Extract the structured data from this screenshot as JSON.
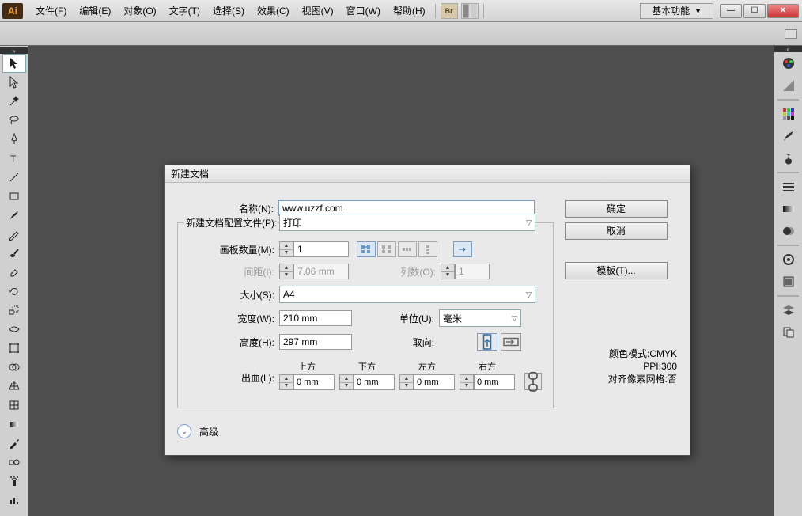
{
  "app": {
    "logo": "Ai"
  },
  "menu": {
    "file": "文件(F)",
    "edit": "编辑(E)",
    "object": "对象(O)",
    "type": "文字(T)",
    "select": "选择(S)",
    "effect": "效果(C)",
    "view": "视图(V)",
    "window": "窗口(W)",
    "help": "帮助(H)"
  },
  "workspace": {
    "label": "基本功能"
  },
  "dialog": {
    "title": "新建文档",
    "name_label": "名称(N):",
    "name_value": "www.uzzf.com",
    "profile_label": "新建文档配置文件(P):",
    "profile_value": "打印",
    "artboards_label": "画板数量(M):",
    "artboards_value": "1",
    "spacing_label": "间距(I):",
    "spacing_value": "7.06 mm",
    "cols_label": "列数(O):",
    "cols_value": "1",
    "size_label": "大小(S):",
    "size_value": "A4",
    "width_label": "宽度(W):",
    "width_value": "210 mm",
    "units_label": "单位(U):",
    "units_value": "毫米",
    "height_label": "高度(H):",
    "height_value": "297 mm",
    "orient_label": "取向:",
    "bleed_label": "出血(L):",
    "bleed_top": "上方",
    "bleed_bottom": "下方",
    "bleed_left": "左方",
    "bleed_right": "右方",
    "bleed_val": "0 mm",
    "advanced": "高级",
    "ok": "确定",
    "cancel": "取消",
    "templates": "模板(T)...",
    "info_mode": "颜色模式:CMYK",
    "info_ppi": "PPI:300",
    "info_align": "对齐像素网格:否"
  }
}
